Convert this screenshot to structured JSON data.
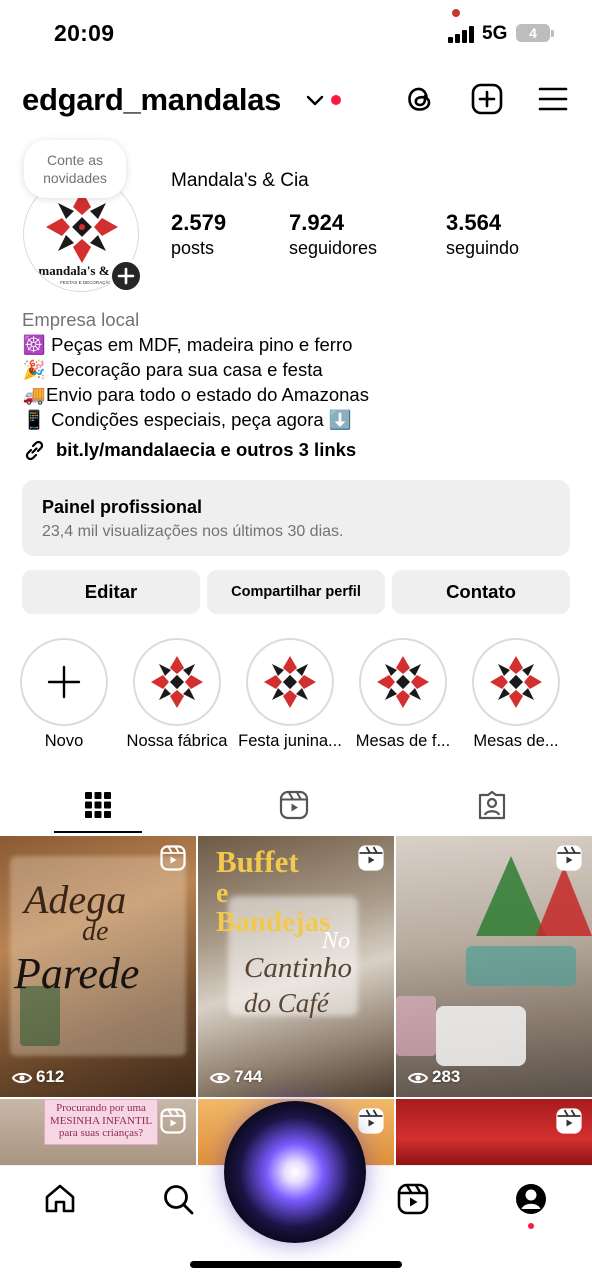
{
  "status_bar": {
    "time": "20:09",
    "network": "5G",
    "battery": "4"
  },
  "header": {
    "username": "edgard_mandalas"
  },
  "profile": {
    "note": "Conte as novidades",
    "display_name": "Mandala's & Cia",
    "avatar_logo_text": "mandala's &",
    "avatar_logo_sub": "FESTAS E DECORAÇÃO",
    "stats": [
      {
        "value": "2.579",
        "label": "posts"
      },
      {
        "value": "7.924",
        "label": "seguidores"
      },
      {
        "value": "3.564",
        "label": "seguindo"
      }
    ]
  },
  "bio": {
    "category": "Empresa local",
    "lines": [
      {
        "emoji": "☸️",
        "text": " Peças em MDF, madeira pino e ferro"
      },
      {
        "emoji": "🎉",
        "text": " Decoração para sua casa e festa"
      },
      {
        "emoji": "🚚",
        "text": "Envio para todo o estado do Amazonas"
      },
      {
        "emoji": "📱",
        "text": " Condições especiais, peça agora ⬇️"
      }
    ],
    "link": "bit.ly/mandalaecia e outros 3 links"
  },
  "pro_panel": {
    "title": "Painel profissional",
    "subtitle": "23,4 mil visualizações nos últimos 30 dias."
  },
  "actions": {
    "edit": "Editar",
    "share": "Compartilhar perfil",
    "contact": "Contato"
  },
  "highlights": [
    {
      "label": "Novo"
    },
    {
      "label": "Nossa fábrica"
    },
    {
      "label": "Festa junina..."
    },
    {
      "label": "Mesas de f..."
    },
    {
      "label": "Mesas de..."
    }
  ],
  "grid": [
    {
      "views": "612",
      "title_lines": [
        "Adega",
        "de",
        "Parede"
      ]
    },
    {
      "views": "744",
      "title_lines": [
        "Buffet",
        "e",
        "Bandejas",
        "No",
        "Cantinho",
        "do Café"
      ]
    },
    {
      "views": "283"
    },
    {
      "caption": "Procurando por uma MESINHA INFANTIL para suas crianças?"
    }
  ],
  "colors": {
    "accent_red": "#ff1744",
    "button_bg": "#efefef",
    "muted_text": "#737373"
  }
}
